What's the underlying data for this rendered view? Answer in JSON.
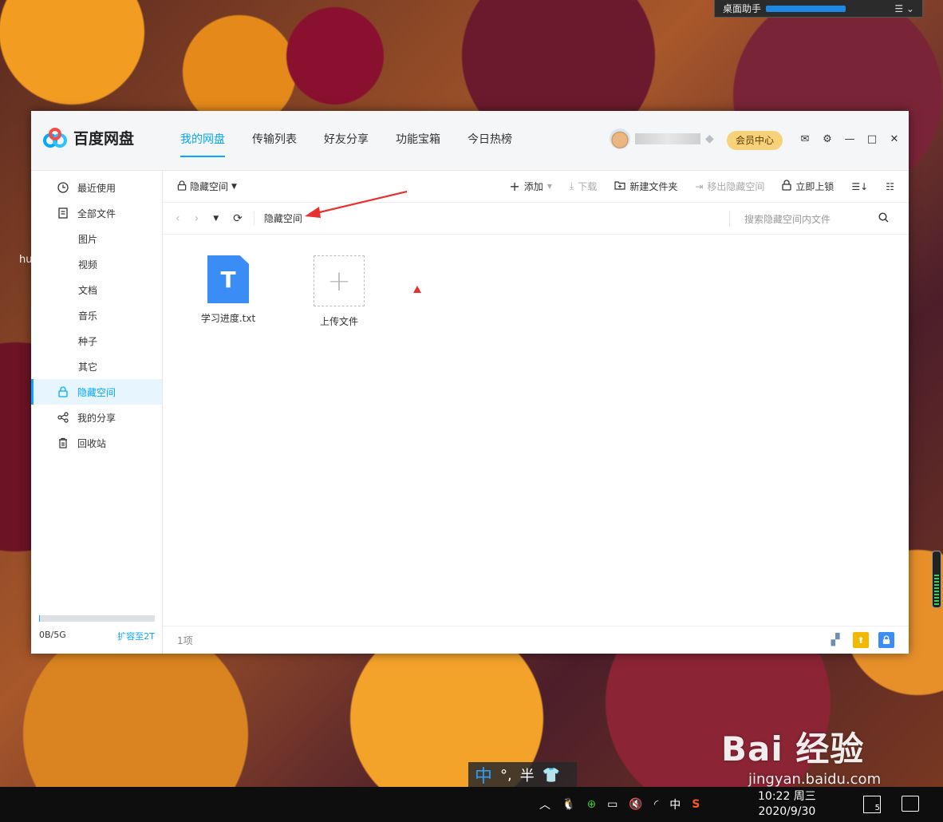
{
  "desktop": {
    "helper_title": "桌面助手",
    "label": "hu"
  },
  "window": {
    "app_name": "百度网盘",
    "tabs": [
      "我的网盘",
      "传输列表",
      "好友分享",
      "功能宝箱",
      "今日热榜"
    ],
    "active_tab": "我的网盘",
    "vip_button": "会员中心"
  },
  "sidebar": {
    "items": [
      {
        "label": "最近使用",
        "icon": "clock-icon"
      },
      {
        "label": "全部文件",
        "icon": "document-icon"
      },
      {
        "label": "图片"
      },
      {
        "label": "视频"
      },
      {
        "label": "文档"
      },
      {
        "label": "音乐"
      },
      {
        "label": "种子"
      },
      {
        "label": "其它"
      },
      {
        "label": "隐藏空间",
        "icon": "lock-icon"
      },
      {
        "label": "我的分享",
        "icon": "share-icon"
      },
      {
        "label": "回收站",
        "icon": "trash-icon"
      }
    ],
    "active_item": "隐藏空间",
    "quota": {
      "used": "0B/5G",
      "expand": "扩容至2T",
      "fill_fraction": 0.01
    }
  },
  "toolbar": {
    "space_label": "隐藏空间",
    "add": "添加",
    "download": "下载",
    "new_folder": "新建文件夹",
    "move_out": "移出隐藏空间",
    "lock_now": "立即上锁"
  },
  "addressbar": {
    "crumb": "隐藏空间",
    "search_placeholder": "搜索隐藏空间内文件"
  },
  "files": [
    {
      "name": "学习进度.txt",
      "icon_letter": "T"
    },
    {
      "name": "上传文件"
    }
  ],
  "statusbar": {
    "count": "1项"
  },
  "ime": {
    "mode": "中",
    "punct": "°,",
    "width": "半"
  },
  "watermark": {
    "main": "Bai 经验",
    "sub": "jingyan.baidu.com"
  },
  "taskbar": {
    "ime_indicator": "中",
    "time": "10:22 周三",
    "date": "2020/9/30",
    "notification_count": "5"
  },
  "colors": {
    "accent": "#06a7ff",
    "vip": "#f8d27a",
    "file_icon": "#3a8df5",
    "annotation": "#e8312f"
  }
}
